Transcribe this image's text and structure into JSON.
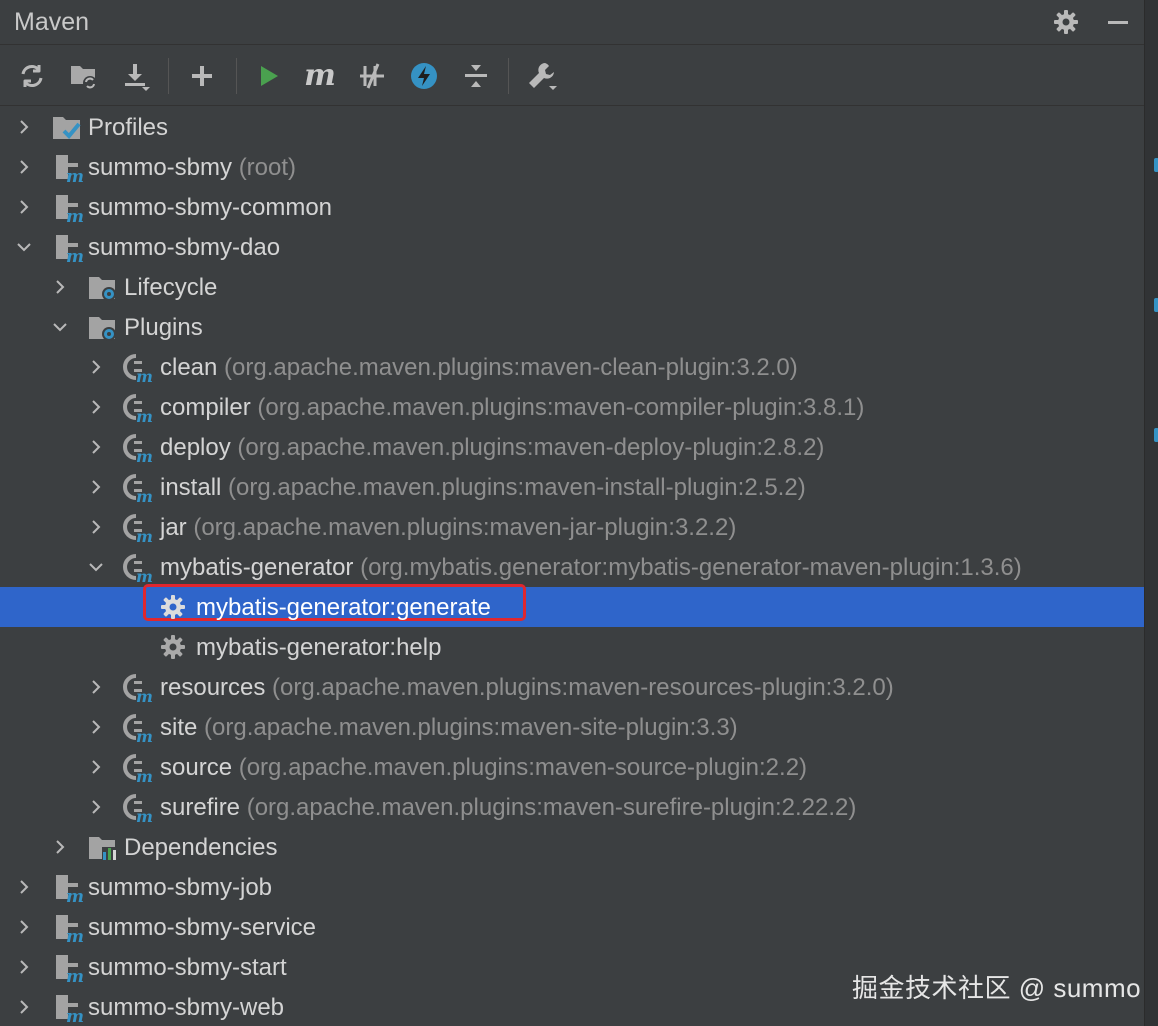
{
  "panel": {
    "title": "Maven"
  },
  "header": {
    "settings_icon": "gear-icon",
    "hide_icon": "minimize-icon"
  },
  "toolbar": {
    "items": [
      {
        "name": "reload-all-icon",
        "tooltip": ""
      },
      {
        "name": "generate-sources-icon",
        "tooltip": ""
      },
      {
        "name": "download-sources-icon",
        "tooltip": ""
      },
      {
        "name": "add-project-icon",
        "tooltip": ""
      },
      {
        "name": "run-icon",
        "tooltip": ""
      },
      {
        "name": "execute-goal-icon",
        "tooltip": ""
      },
      {
        "name": "skip-tests-icon",
        "tooltip": ""
      },
      {
        "name": "offline-mode-icon",
        "tooltip": ""
      },
      {
        "name": "collapse-all-icon",
        "tooltip": ""
      },
      {
        "name": "settings-wrench-icon",
        "tooltip": ""
      }
    ]
  },
  "tree": {
    "rows": [
      {
        "name": "profiles",
        "label": "Profiles",
        "suffix": "",
        "expanded": false
      },
      {
        "name": "summo-sbmy",
        "label": "summo-sbmy",
        "suffix": "(root)",
        "expanded": false
      },
      {
        "name": "summo-sbmy-common",
        "label": "summo-sbmy-common",
        "suffix": "",
        "expanded": false
      },
      {
        "name": "summo-sbmy-dao",
        "label": "summo-sbmy-dao",
        "suffix": "",
        "expanded": true
      },
      {
        "name": "lifecycle",
        "label": "Lifecycle",
        "suffix": "",
        "expanded": false
      },
      {
        "name": "plugins",
        "label": "Plugins",
        "suffix": "",
        "expanded": true
      },
      {
        "name": "plugin-clean",
        "label": "clean",
        "suffix": "(org.apache.maven.plugins:maven-clean-plugin:3.2.0)",
        "expanded": false
      },
      {
        "name": "plugin-compiler",
        "label": "compiler",
        "suffix": "(org.apache.maven.plugins:maven-compiler-plugin:3.8.1)",
        "expanded": false
      },
      {
        "name": "plugin-deploy",
        "label": "deploy",
        "suffix": "(org.apache.maven.plugins:maven-deploy-plugin:2.8.2)",
        "expanded": false
      },
      {
        "name": "plugin-install",
        "label": "install",
        "suffix": "(org.apache.maven.plugins:maven-install-plugin:2.5.2)",
        "expanded": false
      },
      {
        "name": "plugin-jar",
        "label": "jar",
        "suffix": "(org.apache.maven.plugins:maven-jar-plugin:3.2.2)",
        "expanded": false
      },
      {
        "name": "plugin-mybatis-generator",
        "label": "mybatis-generator",
        "suffix": "(org.mybatis.generator:mybatis-generator-maven-plugin:1.3.6)",
        "expanded": true
      },
      {
        "name": "goal-mybatis-generator-generate",
        "label": "mybatis-generator:generate",
        "suffix": "",
        "selected": true
      },
      {
        "name": "goal-mybatis-generator-help",
        "label": "mybatis-generator:help",
        "suffix": ""
      },
      {
        "name": "plugin-resources",
        "label": "resources",
        "suffix": "(org.apache.maven.plugins:maven-resources-plugin:3.2.0)",
        "expanded": false
      },
      {
        "name": "plugin-site",
        "label": "site",
        "suffix": "(org.apache.maven.plugins:maven-site-plugin:3.3)",
        "expanded": false
      },
      {
        "name": "plugin-source",
        "label": "source",
        "suffix": "(org.apache.maven.plugins:maven-source-plugin:2.2)",
        "expanded": false
      },
      {
        "name": "plugin-surefire",
        "label": "surefire",
        "suffix": "(org.apache.maven.plugins:maven-surefire-plugin:2.22.2)",
        "expanded": false
      },
      {
        "name": "dependencies",
        "label": "Dependencies",
        "suffix": "",
        "expanded": false
      },
      {
        "name": "summo-sbmy-job",
        "label": "summo-sbmy-job",
        "suffix": "",
        "expanded": false
      },
      {
        "name": "summo-sbmy-service",
        "label": "summo-sbmy-service",
        "suffix": "",
        "expanded": false
      },
      {
        "name": "summo-sbmy-start",
        "label": "summo-sbmy-start",
        "suffix": "",
        "expanded": false
      },
      {
        "name": "summo-sbmy-web",
        "label": "summo-sbmy-web",
        "suffix": "",
        "expanded": false
      }
    ]
  },
  "colors": {
    "selection": "#2f65ca",
    "highlight_box": "#e0272e",
    "run_green": "#4aa14f",
    "maven_blue": "#3592c4"
  },
  "watermark": {
    "text": "掘金技术社区 @ summo"
  }
}
